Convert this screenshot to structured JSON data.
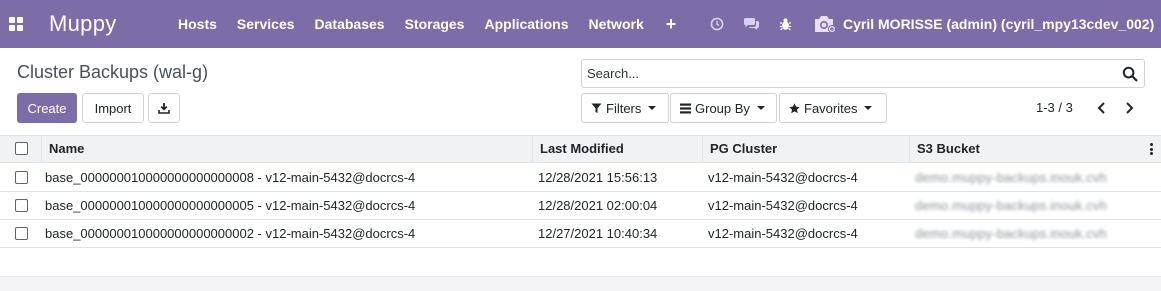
{
  "navbar": {
    "brand": "Muppy",
    "menu": [
      "Hosts",
      "Services",
      "Databases",
      "Storages",
      "Applications",
      "Network"
    ],
    "plus": "+",
    "user": "Cyril MORISSE (admin) (cyril_mpy13cdev_002)",
    "colors": {
      "bar": "#7c6ca8",
      "text": "#ffffff"
    }
  },
  "control_panel": {
    "title": "Cluster Backups (wal-g)",
    "create_label": "Create",
    "import_label": "Import",
    "search": {
      "placeholder": "Search..."
    },
    "filters_label": "Filters",
    "groupby_label": "Group By",
    "favorites_label": "Favorites",
    "pager": "1-3 / 3"
  },
  "table": {
    "columns": [
      "Name",
      "Last Modified",
      "PG Cluster",
      "S3 Bucket"
    ],
    "rows": [
      {
        "name": "base_000000010000000000000008 - v12-main-5432@docrcs-4",
        "last_modified": "12/28/2021 15:56:13",
        "pg_cluster": "v12-main-5432@docrcs-4",
        "s3_bucket": "demo.muppy-backups.inouk.cvh"
      },
      {
        "name": "base_000000010000000000000005 - v12-main-5432@docrcs-4",
        "last_modified": "12/28/2021 02:00:04",
        "pg_cluster": "v12-main-5432@docrcs-4",
        "s3_bucket": "demo.muppy-backups.inouk.cvh"
      },
      {
        "name": "base_000000010000000000000002 - v12-main-5432@docrcs-4",
        "last_modified": "12/27/2021 10:40:34",
        "pg_cluster": "v12-main-5432@docrcs-4",
        "s3_bucket": "demo.muppy-backups.inouk.cvh"
      }
    ]
  },
  "icons": {
    "apps": "apps-grid-icon",
    "clock": "clock-icon",
    "chat": "chat-icon",
    "debug": "bug-icon",
    "avatar": "camera-avatar-icon",
    "download": "download-icon",
    "search": "search-icon",
    "filter": "filter-icon",
    "groupby": "list-icon",
    "favorite": "star-icon",
    "prev": "chevron-left-icon",
    "next": "chevron-right-icon",
    "column_options": "vertical-dots-icon"
  }
}
